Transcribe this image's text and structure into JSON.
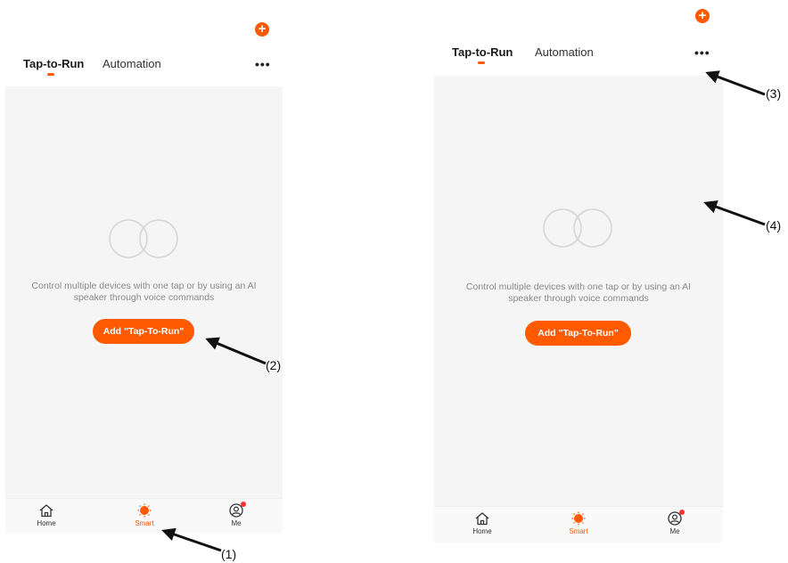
{
  "screens": [
    {
      "tabs": {
        "active": "Tap-to-Run",
        "inactive": "Automation"
      },
      "empty_state": {
        "line1": "Control multiple devices with one tap or by using an AI",
        "line2": "speaker through voice commands"
      },
      "add_button": "Add \"Tap-To-Run\"",
      "nav": {
        "home": "Home",
        "smart": "Smart",
        "me": "Me"
      }
    },
    {
      "tabs": {
        "active": "Tap-to-Run",
        "inactive": "Automation"
      },
      "empty_state": {
        "line1": "Control multiple devices with one tap or by using an AI",
        "line2": "speaker through voice commands"
      },
      "add_button": "Add \"Tap-To-Run\"",
      "nav": {
        "home": "Home",
        "smart": "Smart",
        "me": "Me"
      }
    }
  ],
  "annotations": [
    "(1)",
    "(2)",
    "(3)",
    "(4)"
  ],
  "icons": [
    "plus-icon",
    "more-icon",
    "empty-circles-icon",
    "home-icon",
    "smart-sun-icon",
    "me-avatar-icon"
  ],
  "colors": {
    "accent": "#ff5a00",
    "background": "#f5f5f5",
    "badge": "#ff3030"
  }
}
